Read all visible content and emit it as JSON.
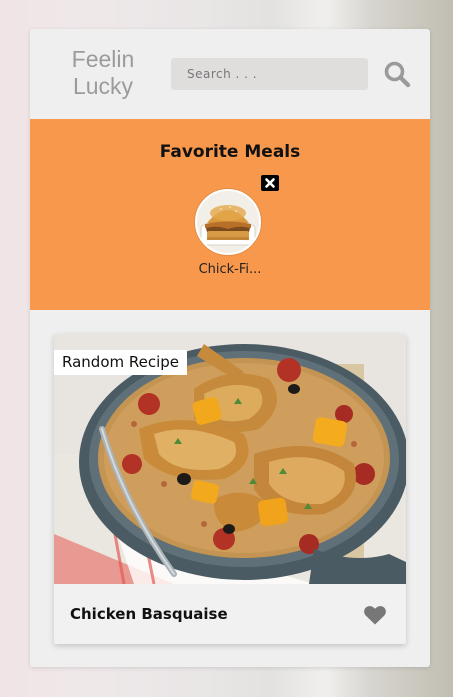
{
  "header": {
    "logo_line1": "Feelin",
    "logo_line2": "Lucky",
    "search_placeholder": "Search . . .",
    "search_value": "",
    "search_icon": "search-icon"
  },
  "favorites": {
    "title": "Favorite Meals",
    "background_color": "#f7984c",
    "items": [
      {
        "name": "Chick-Fi...",
        "thumbnail": "chicken-sandwich-image",
        "remove_icon": "close-icon"
      }
    ]
  },
  "random_card": {
    "tag": "Random Recipe",
    "title": "Chicken Basquaise",
    "image": "chicken-basquaise-dish-image",
    "favorite_icon": "heart-icon",
    "favorite_icon_color": "#777777"
  }
}
